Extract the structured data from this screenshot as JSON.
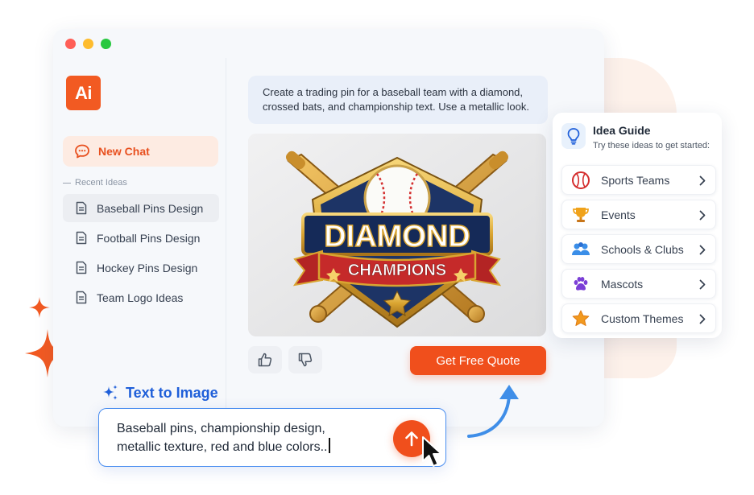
{
  "window": {
    "controls": [
      "close",
      "minimize",
      "maximize"
    ]
  },
  "sidebar": {
    "logo_text": "Ai",
    "new_chat_label": "New Chat",
    "recent_title": "Recent Ideas",
    "recent_items": [
      {
        "label": "Baseball Pins Design",
        "active": true
      },
      {
        "label": "Football Pins Design",
        "active": false
      },
      {
        "label": "Hockey Pins Design",
        "active": false
      },
      {
        "label": "Team Logo Ideas",
        "active": false
      }
    ]
  },
  "chat": {
    "prompt_line1": "Create a trading pin for a baseball team with a diamond,",
    "prompt_line2": "crossed bats, and championship text. Use a metallic look.",
    "generated_image": {
      "description_icon": "baseball-pin-image",
      "title_text": "DIAMOND",
      "banner_text": "CHAMPIONS"
    },
    "like_icon": "thumbs-up-icon",
    "dislike_icon": "thumbs-down-icon",
    "quote_button_label": "Get Free Quote"
  },
  "idea_guide": {
    "title": "Idea Guide",
    "subtitle": "Try these ideas to get started:",
    "items": [
      {
        "label": "Sports Teams",
        "icon": "baseball-icon"
      },
      {
        "label": "Events",
        "icon": "trophy-icon"
      },
      {
        "label": "Schools & Clubs",
        "icon": "people-icon"
      },
      {
        "label": "Mascots",
        "icon": "paw-icon"
      },
      {
        "label": "Custom Themes",
        "icon": "star-icon"
      }
    ]
  },
  "text_to_image": {
    "label": "Text to Image",
    "input_line1": "Baseball pins, championship design,",
    "input_line2": "metallic texture, red and blue colors.."
  },
  "colors": {
    "accent": "#f04f1c",
    "brand_blue": "#1f5fd9",
    "input_border": "#4a8ef0"
  }
}
